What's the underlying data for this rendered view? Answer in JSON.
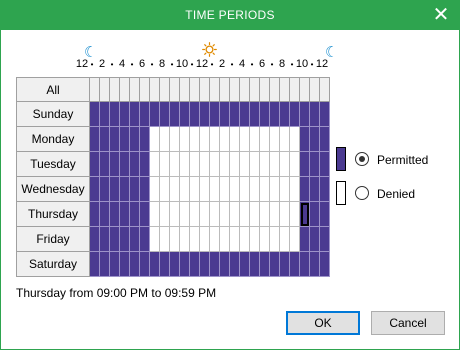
{
  "dialog": {
    "title": "TIME PERIODS",
    "close_icon": "close-icon"
  },
  "timeline": {
    "labels": [
      "12",
      "2",
      "4",
      "6",
      "8",
      "10",
      "12",
      "2",
      "4",
      "6",
      "8",
      "10",
      "12"
    ],
    "icons": [
      "moon-icon",
      "sun-icon",
      "moon-icon"
    ]
  },
  "grid": {
    "all_label": "All",
    "days": [
      "Sunday",
      "Monday",
      "Tuesday",
      "Wednesday",
      "Thursday",
      "Friday",
      "Saturday"
    ],
    "hours": 24,
    "permitted": [
      [
        0,
        1,
        2,
        3,
        4,
        5,
        6,
        7,
        8,
        9,
        10,
        11,
        12,
        13,
        14,
        15,
        16,
        17,
        18,
        19,
        20,
        21,
        22,
        23
      ],
      [
        0,
        1,
        2,
        3,
        4,
        5,
        21,
        22,
        23
      ],
      [
        0,
        1,
        2,
        3,
        4,
        5,
        21,
        22,
        23
      ],
      [
        0,
        1,
        2,
        3,
        4,
        5,
        21,
        22,
        23
      ],
      [
        0,
        1,
        2,
        3,
        4,
        5,
        21,
        22,
        23
      ],
      [
        0,
        1,
        2,
        3,
        4,
        5,
        21,
        22,
        23
      ],
      [
        0,
        1,
        2,
        3,
        4,
        5,
        6,
        7,
        8,
        9,
        10,
        11,
        12,
        13,
        14,
        15,
        16,
        17,
        18,
        19,
        20,
        21,
        22,
        23
      ]
    ],
    "selected_day": 4,
    "selected_hour": 21
  },
  "legend": {
    "permitted_label": "Permitted",
    "denied_label": "Denied",
    "selected": "permitted",
    "permitted_color": "#4b3a91",
    "denied_color": "#ffffff"
  },
  "status_text": "Thursday from 09:00 PM to 09:59 PM",
  "buttons": {
    "ok": "OK",
    "cancel": "Cancel"
  },
  "colors": {
    "titlebar": "#2ea44f",
    "permitted": "#4b3a91"
  }
}
